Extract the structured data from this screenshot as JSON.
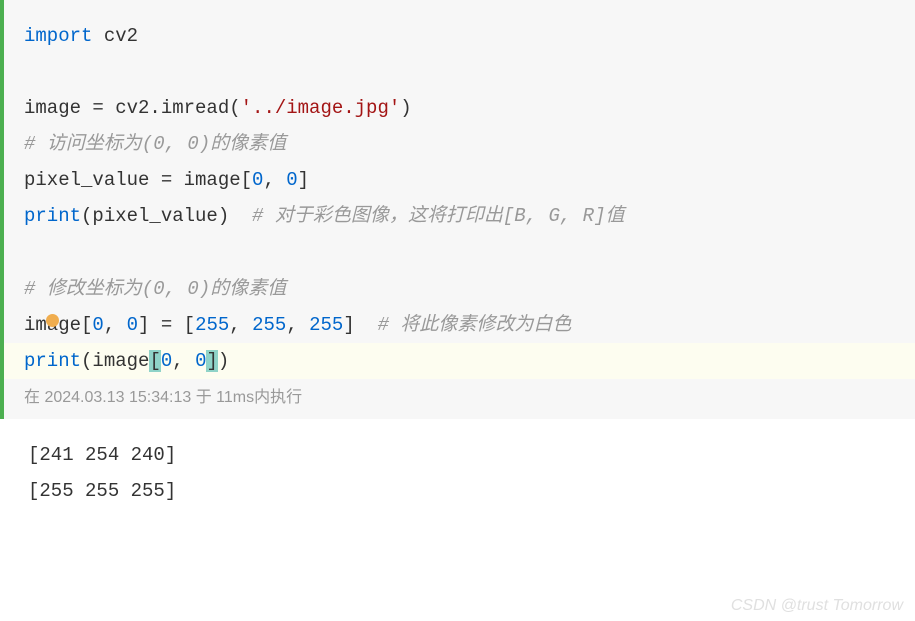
{
  "code": {
    "line1_import": "import",
    "line1_mod": " cv2",
    "line3_a": "image = cv2.imread(",
    "line3_str": "'../image.jpg'",
    "line3_b": ")",
    "line4_comment": "# 访问坐标为(0, 0)的像素值",
    "line5_a": "pixel_value = image[",
    "line5_n1": "0",
    "line5_b": ", ",
    "line5_n2": "0",
    "line5_c": "]",
    "line6_a": "print",
    "line6_b": "(pixel_value)  ",
    "line6_comment": "# 对于彩色图像，这将打印出[B, G, R]值",
    "line8_comment": "# 修改坐标为(0, 0)的像素值",
    "line9_a": "image[",
    "line9_n1": "0",
    "line9_b": ", ",
    "line9_n2": "0",
    "line9_c": "] = [",
    "line9_n3": "255",
    "line9_d": ", ",
    "line9_n4": "255",
    "line9_e": ", ",
    "line9_n5": "255",
    "line9_f": "]  ",
    "line9_comment": "# 将此像素修改为白色",
    "line10_a": "print",
    "line10_b": "(image",
    "line10_br1": "[",
    "line10_n1": "0",
    "line10_c": ", ",
    "line10_n2": "0",
    "line10_br2": "]",
    "line10_d": ")"
  },
  "exec_info": "在 2024.03.13 15:34:13 于 11ms内执行",
  "output": {
    "line1": "[241 254 240]",
    "line2": "[255 255 255]"
  },
  "watermark": "CSDN @trust Tomorrow"
}
